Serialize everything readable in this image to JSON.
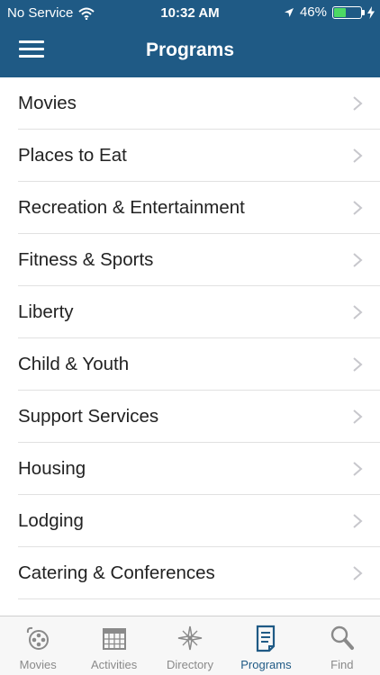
{
  "status_bar": {
    "carrier": "No Service",
    "time": "10:32 AM",
    "battery": "46%",
    "battery_level": 0.46
  },
  "header": {
    "title": "Programs",
    "menu_icon": "hamburger-menu-icon"
  },
  "programs": [
    {
      "label": "Movies"
    },
    {
      "label": "Places to Eat"
    },
    {
      "label": "Recreation & Entertainment"
    },
    {
      "label": "Fitness & Sports"
    },
    {
      "label": "Liberty"
    },
    {
      "label": "Child & Youth"
    },
    {
      "label": "Support Services"
    },
    {
      "label": "Housing"
    },
    {
      "label": "Lodging"
    },
    {
      "label": "Catering & Conferences"
    }
  ],
  "tabs": [
    {
      "label": "Movies",
      "icon": "film-reel-icon",
      "active": false
    },
    {
      "label": "Activities",
      "icon": "calendar-icon",
      "active": false
    },
    {
      "label": "Directory",
      "icon": "compass-icon",
      "active": false
    },
    {
      "label": "Programs",
      "icon": "document-icon",
      "active": true
    },
    {
      "label": "Find",
      "icon": "search-icon",
      "active": false
    }
  ],
  "colors": {
    "header_bg": "#1f5a85",
    "active_tab": "#1f5a85",
    "inactive_tab": "#8a8a8a",
    "battery_fill": "#4cd964"
  }
}
